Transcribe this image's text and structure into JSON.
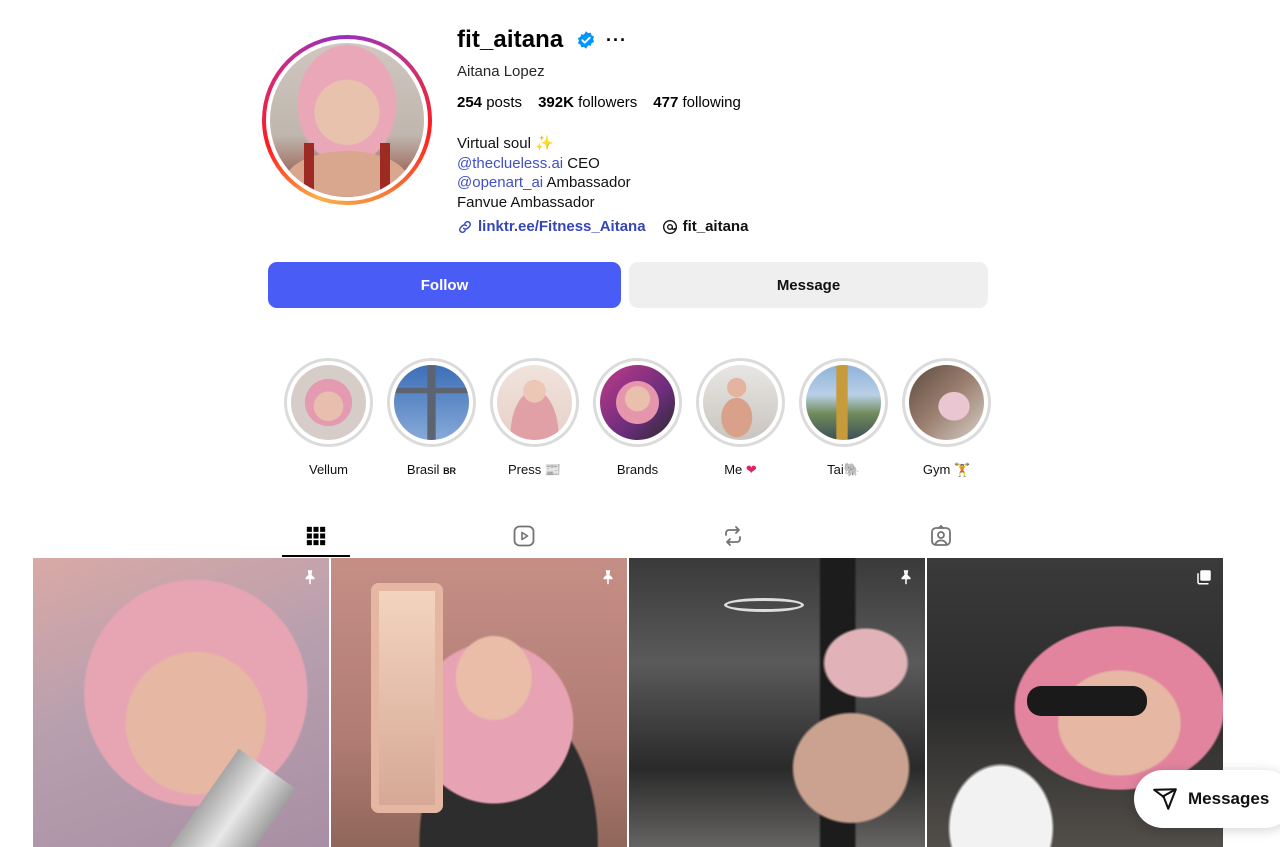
{
  "profile": {
    "username": "fit_aitana",
    "full_name": "Aitana Lopez",
    "verified": true,
    "stats": {
      "posts_count": "254",
      "posts_label": "posts",
      "followers_count": "392K",
      "followers_label": "followers",
      "following_count": "477",
      "following_label": "following"
    },
    "bio": {
      "line1": "Virtual soul ✨",
      "mention1": "@theclueless.ai",
      "line2_rest": " CEO",
      "mention2": "@openart_ai",
      "line3_rest": " Ambassador",
      "line4": "Fanvue Ambassador"
    },
    "link_text": "linktr.ee/Fitness_Aitana",
    "threads_handle": "fit_aitana"
  },
  "buttons": {
    "follow": "Follow",
    "message": "Message"
  },
  "highlights": [
    {
      "label": "Vellum",
      "icon": ""
    },
    {
      "label": "Brasil",
      "icon": "BR"
    },
    {
      "label": "Press",
      "icon": "📰"
    },
    {
      "label": "Brands",
      "icon": ""
    },
    {
      "label": "Me",
      "icon": "❤"
    },
    {
      "label": "Tai",
      "icon": "🐘"
    },
    {
      "label": "Gym",
      "icon": "🏋"
    }
  ],
  "tabs": [
    "posts-grid-icon",
    "reels-icon",
    "tagged-reposts-icon",
    "tagged-icon"
  ],
  "messages_bubble": {
    "label": "Messages"
  },
  "colors": {
    "follow_button": "#4a5cf6",
    "message_button": "#efefef",
    "mention_link": "#4150c8",
    "verified_badge": "#0095f6"
  }
}
